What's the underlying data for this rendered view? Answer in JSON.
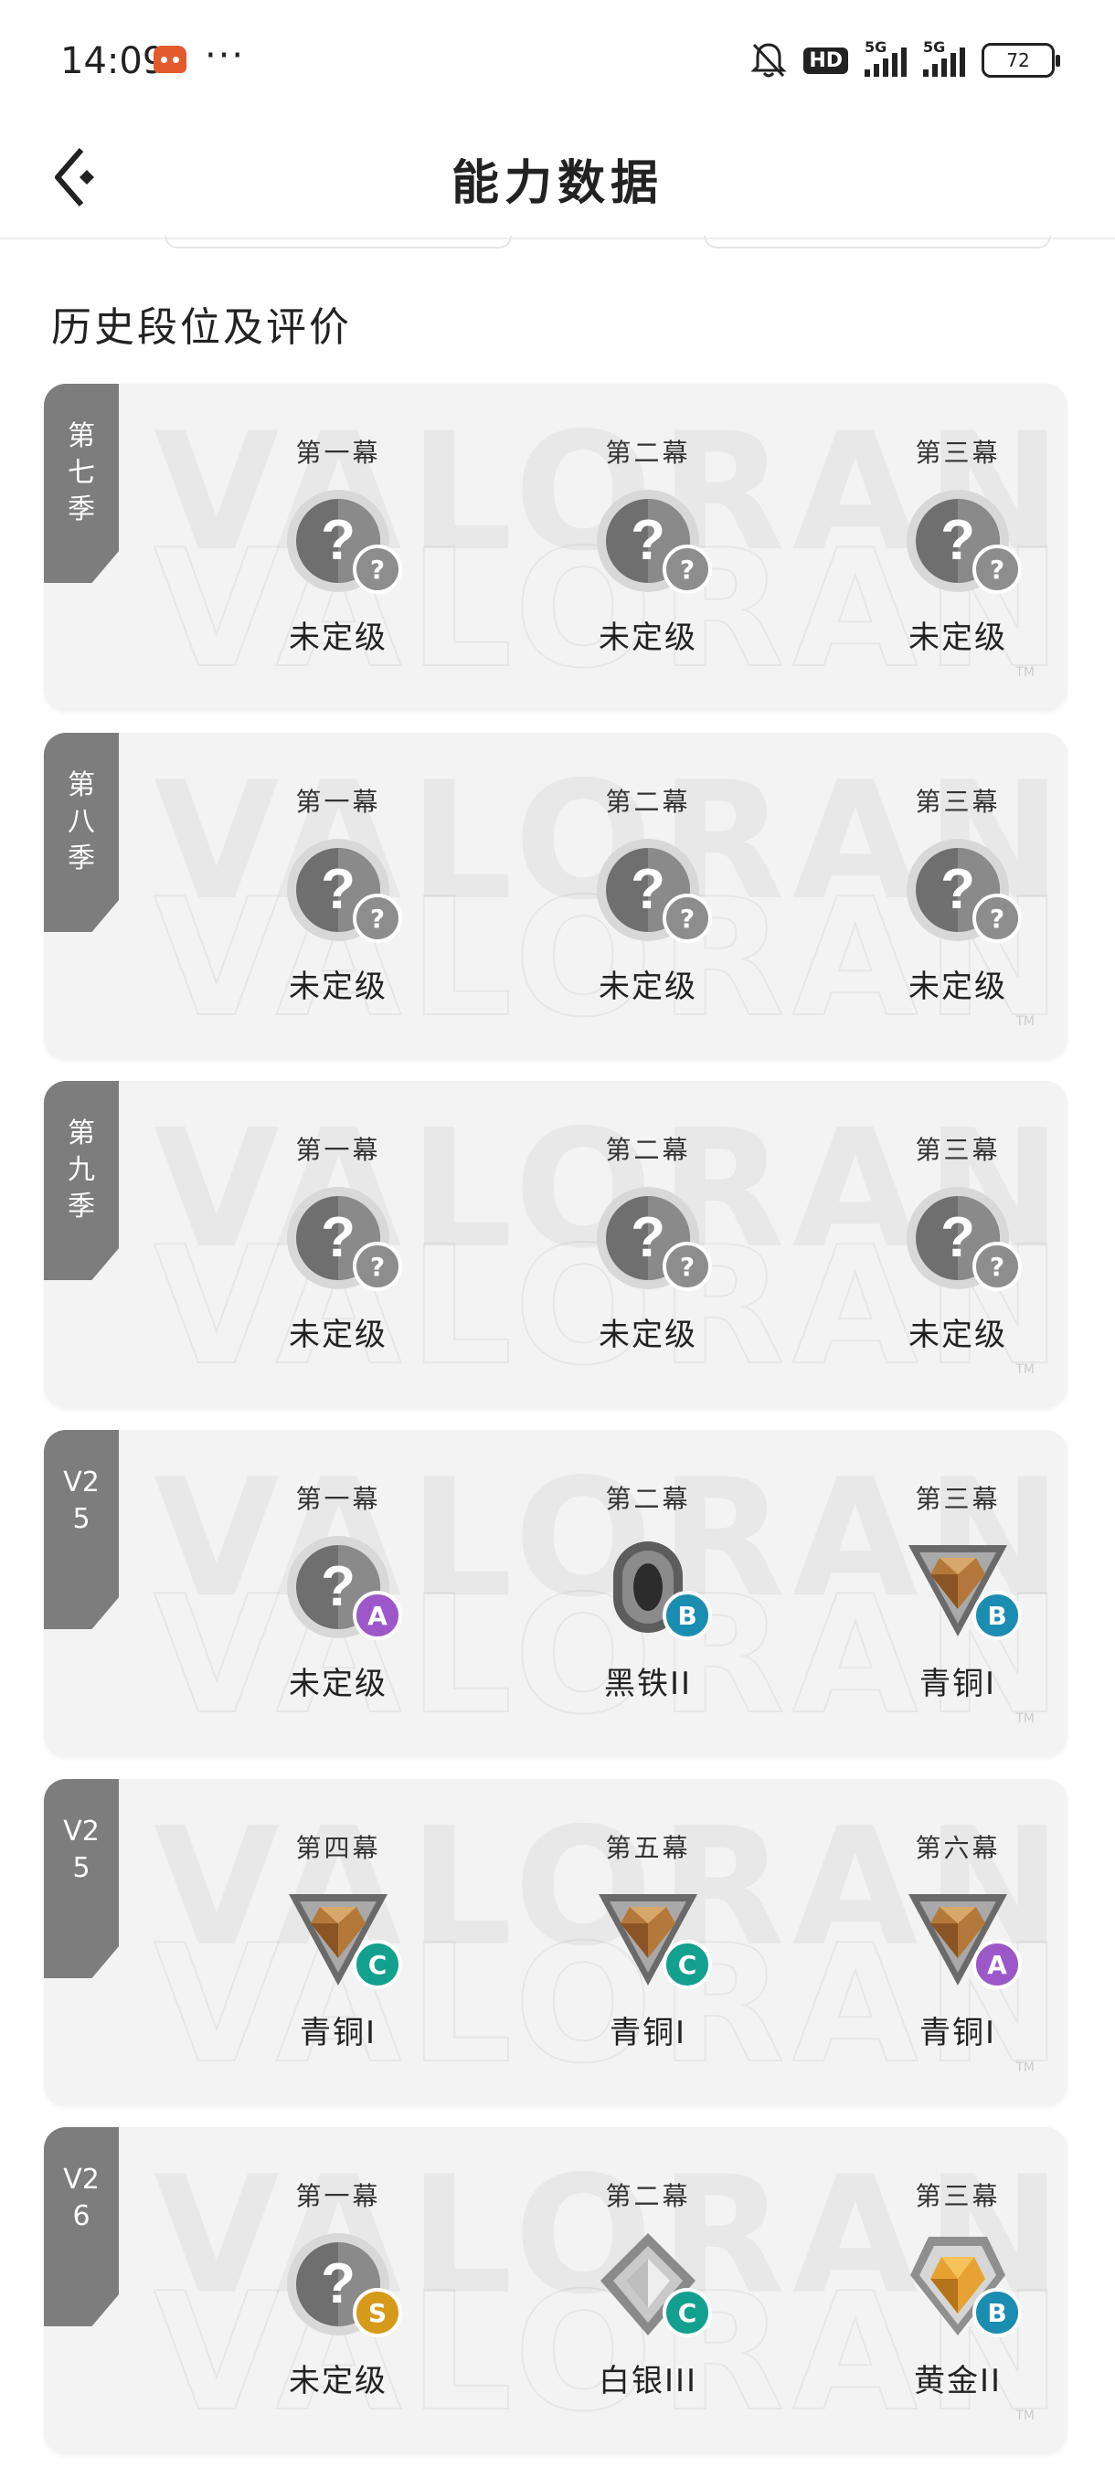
{
  "status_bar": {
    "time": "14:09",
    "menu_dots": "···",
    "hd_label": "HD",
    "network_1": "5G",
    "network_2": "5G",
    "battery": "72",
    "icons": [
      "app-notification-icon",
      "bell-off-icon",
      "signal-icon",
      "battery-icon"
    ]
  },
  "header": {
    "title": "能力数据",
    "back_icon": "back-arrow-icon"
  },
  "section_title": "历史段位及评价",
  "watermark": "VALORANT",
  "cards": [
    {
      "tag": "第七季",
      "acts": [
        {
          "label": "第一幕",
          "rank": "未定级",
          "icon": "unranked-icon",
          "grade": "?"
        },
        {
          "label": "第二幕",
          "rank": "未定级",
          "icon": "unranked-icon",
          "grade": "?"
        },
        {
          "label": "第三幕",
          "rank": "未定级",
          "icon": "unranked-icon",
          "grade": "?"
        }
      ]
    },
    {
      "tag": "第八季",
      "acts": [
        {
          "label": "第一幕",
          "rank": "未定级",
          "icon": "unranked-icon",
          "grade": "?"
        },
        {
          "label": "第二幕",
          "rank": "未定级",
          "icon": "unranked-icon",
          "grade": "?"
        },
        {
          "label": "第三幕",
          "rank": "未定级",
          "icon": "unranked-icon",
          "grade": "?"
        }
      ]
    },
    {
      "tag": "第九季",
      "acts": [
        {
          "label": "第一幕",
          "rank": "未定级",
          "icon": "unranked-icon",
          "grade": "?"
        },
        {
          "label": "第二幕",
          "rank": "未定级",
          "icon": "unranked-icon",
          "grade": "?"
        },
        {
          "label": "第三幕",
          "rank": "未定级",
          "icon": "unranked-icon",
          "grade": "?"
        }
      ]
    },
    {
      "tag": "V25",
      "acts": [
        {
          "label": "第一幕",
          "rank": "未定级",
          "icon": "unranked-icon",
          "grade": "A"
        },
        {
          "label": "第二幕",
          "rank": "黑铁II",
          "icon": "iron-rank-icon",
          "grade": "B"
        },
        {
          "label": "第三幕",
          "rank": "青铜I",
          "icon": "bronze-rank-icon",
          "grade": "B"
        }
      ]
    },
    {
      "tag": "V25",
      "acts": [
        {
          "label": "第四幕",
          "rank": "青铜I",
          "icon": "bronze-rank-icon",
          "grade": "C"
        },
        {
          "label": "第五幕",
          "rank": "青铜I",
          "icon": "bronze-rank-icon",
          "grade": "C"
        },
        {
          "label": "第六幕",
          "rank": "青铜I",
          "icon": "bronze-rank-icon",
          "grade": "A"
        }
      ]
    },
    {
      "tag": "V26",
      "acts": [
        {
          "label": "第一幕",
          "rank": "未定级",
          "icon": "unranked-icon",
          "grade": "S"
        },
        {
          "label": "第二幕",
          "rank": "白银III",
          "icon": "silver-rank-icon",
          "grade": "C"
        },
        {
          "label": "第三幕",
          "rank": "黄金II",
          "icon": "gold-rank-icon",
          "grade": "B"
        }
      ]
    }
  ]
}
